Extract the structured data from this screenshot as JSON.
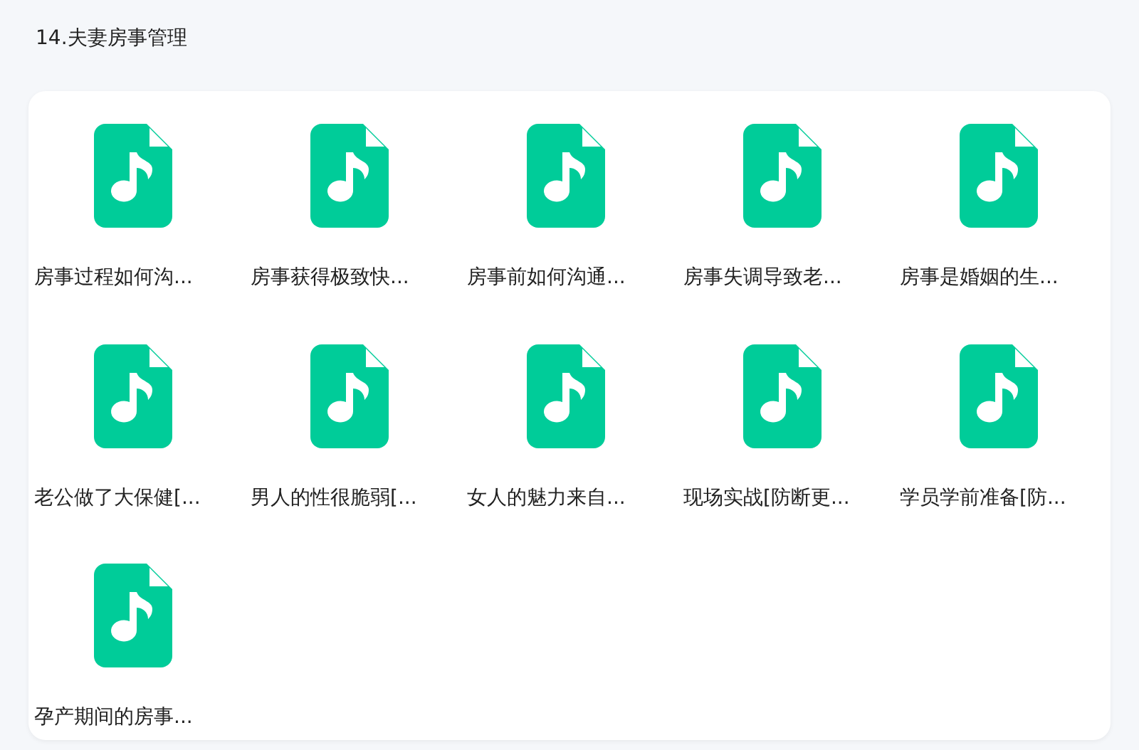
{
  "title": "14.夫妻房事管理",
  "files": [
    {
      "name": "房事过程如何沟..."
    },
    {
      "name": "房事获得极致快..."
    },
    {
      "name": "房事前如何沟通..."
    },
    {
      "name": "房事失调导致老..."
    },
    {
      "name": "房事是婚姻的生..."
    },
    {
      "name": "老公做了大保健[..."
    },
    {
      "name": "男人的性很脆弱[..."
    },
    {
      "name": "女人的魅力来自..."
    },
    {
      "name": "现场实战[防断更..."
    },
    {
      "name": "学员学前准备[防..."
    },
    {
      "name": "孕产期间的房事..."
    }
  ]
}
